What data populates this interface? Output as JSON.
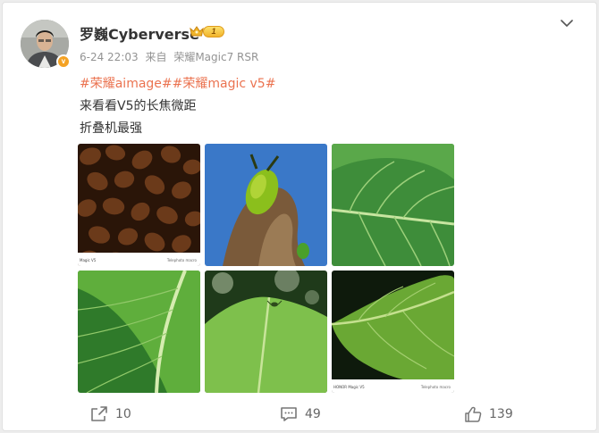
{
  "post": {
    "author": "罗巍Cyberverse",
    "level": "1",
    "verified_mark": "v",
    "timestamp": "6-24 22:03",
    "source_prefix": "来自",
    "source_device": "荣耀Magic7 RSR",
    "topics": [
      "#荣耀aimage#",
      "#荣耀magic v5#"
    ],
    "lines": [
      "来看看V5的长焦微距",
      "折叠机最强"
    ]
  },
  "images": [
    {
      "subject": "coffee beans",
      "watermark_left": "Magic V5",
      "watermark_right": "Telephoto macro"
    },
    {
      "subject": "green beetle on wood"
    },
    {
      "subject": "green leaf close-up"
    },
    {
      "subject": "leaf midrib"
    },
    {
      "subject": "leaf with small bug"
    },
    {
      "subject": "leaf on dark background",
      "watermark_left": "HONOR Magic V5",
      "watermark_right": "Telephoto macro"
    }
  ],
  "actions": {
    "repost_count": "10",
    "comment_count": "49",
    "like_count": "139"
  },
  "icons": {
    "menu": "chevron-down-icon",
    "repost": "share-icon",
    "comment": "comment-icon",
    "like": "thumbs-up-icon"
  },
  "colors": {
    "topic": "#eb7350",
    "text": "#333333",
    "meta": "#939393"
  }
}
